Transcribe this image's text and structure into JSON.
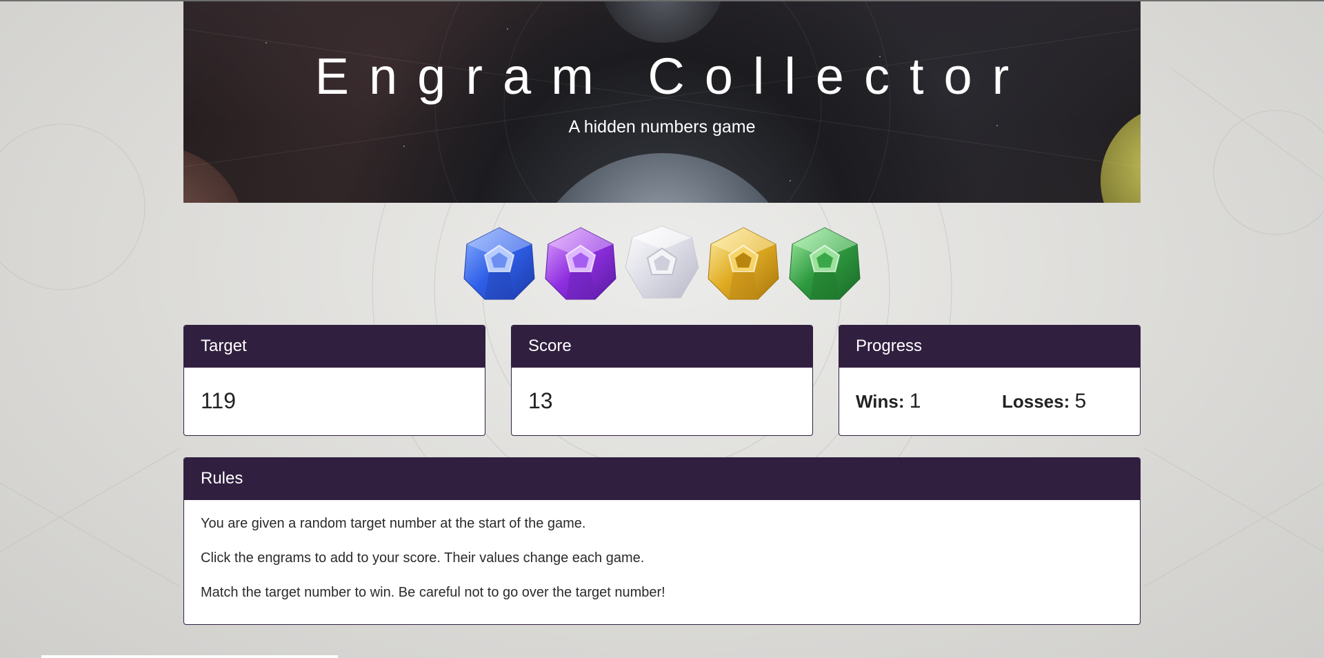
{
  "header": {
    "title": "Engram Collector",
    "subtitle": "A hidden numbers game"
  },
  "engrams": [
    {
      "name": "blue-engram",
      "color": "#3b6cf2"
    },
    {
      "name": "purple-engram",
      "color": "#9a3ee8"
    },
    {
      "name": "white-engram",
      "color": "#e9e9ef"
    },
    {
      "name": "gold-engram",
      "color": "#e3b12a"
    },
    {
      "name": "green-engram",
      "color": "#2e9a3f"
    }
  ],
  "target": {
    "label": "Target",
    "value": "119"
  },
  "score": {
    "label": "Score",
    "value": "13"
  },
  "progress": {
    "label": "Progress",
    "wins_label": "Wins:",
    "wins_value": "1",
    "losses_label": "Losses:",
    "losses_value": "5"
  },
  "rules": {
    "label": "Rules",
    "lines": [
      "You are given a random target number at the start of the game.",
      "Click the engrams to add to your score. Their values change each game.",
      "Match the target number to win. Be careful not to go over the target number!"
    ]
  },
  "colors": {
    "panel_header": "#311f40",
    "page_background": "#dcdbd8"
  }
}
